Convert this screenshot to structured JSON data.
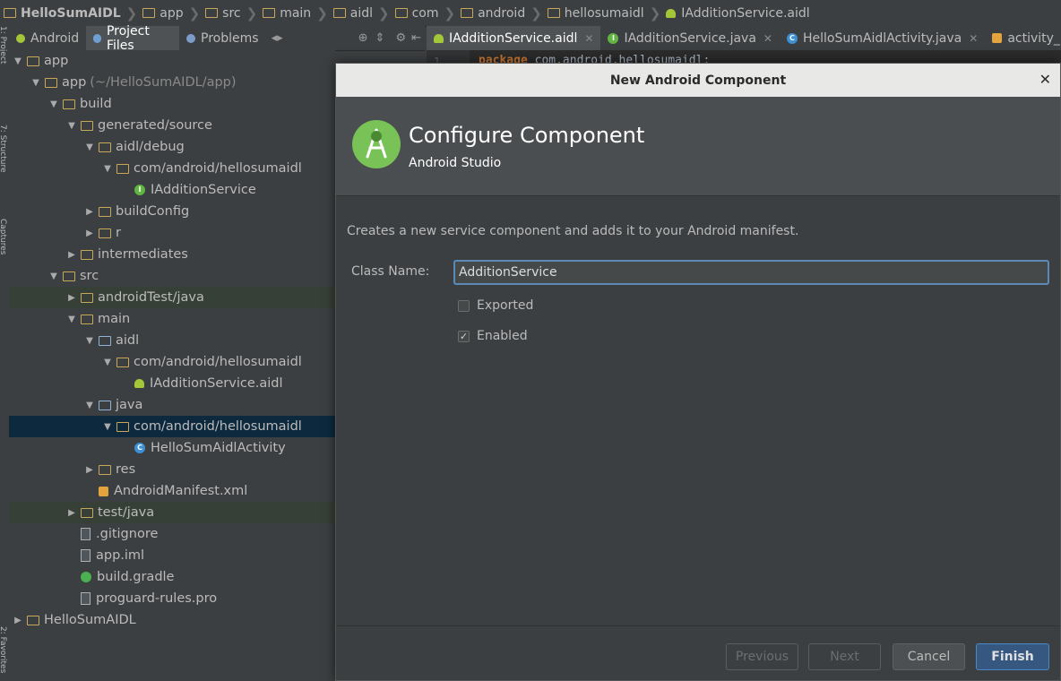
{
  "breadcrumb": [
    {
      "label": "HelloSumAIDL",
      "icon": "project-icon"
    },
    {
      "label": "app",
      "icon": "folder-icon"
    },
    {
      "label": "src",
      "icon": "folder-icon"
    },
    {
      "label": "main",
      "icon": "folder-icon"
    },
    {
      "label": "aidl",
      "icon": "folder-icon"
    },
    {
      "label": "com",
      "icon": "folder-icon"
    },
    {
      "label": "android",
      "icon": "folder-icon"
    },
    {
      "label": "hellosumaidl",
      "icon": "folder-icon"
    },
    {
      "label": "IAdditionService.aidl",
      "icon": "android-icon"
    }
  ],
  "left_strip": {
    "project": "1: Project",
    "structure": "7: Structure",
    "captures": "Captures",
    "favorites": "2: Favorites"
  },
  "project_tabs": [
    {
      "label": "Android",
      "icon": "android-icon"
    },
    {
      "label": "Project Files",
      "icon": "project-files-icon",
      "active": true
    },
    {
      "label": "Problems",
      "icon": "problems-icon"
    }
  ],
  "tree": [
    {
      "label": "app",
      "depth": 0,
      "arrow": "▼",
      "icon": "folder"
    },
    {
      "label": "app",
      "muted": "(~/HelloSumAIDL/app)",
      "depth": 1,
      "arrow": "▼",
      "icon": "folder"
    },
    {
      "label": "build",
      "depth": 2,
      "arrow": "▼",
      "icon": "folder"
    },
    {
      "label": "generated/source",
      "depth": 3,
      "arrow": "▼",
      "icon": "folder"
    },
    {
      "label": "aidl/debug",
      "depth": 4,
      "arrow": "▼",
      "icon": "folder"
    },
    {
      "label": "com/android/hellosumaidl",
      "depth": 5,
      "arrow": "▼",
      "icon": "folder"
    },
    {
      "label": "IAdditionService",
      "depth": 6,
      "arrow": "",
      "icon": "interface"
    },
    {
      "label": "buildConfig",
      "depth": 4,
      "arrow": "▶",
      "icon": "folder"
    },
    {
      "label": "r",
      "depth": 4,
      "arrow": "▶",
      "icon": "folder"
    },
    {
      "label": "intermediates",
      "depth": 3,
      "arrow": "▶",
      "icon": "folder"
    },
    {
      "label": "src",
      "depth": 2,
      "arrow": "▼",
      "icon": "folder"
    },
    {
      "label": "androidTest/java",
      "depth": 3,
      "arrow": "▶",
      "icon": "folder",
      "highlight": "green"
    },
    {
      "label": "main",
      "depth": 3,
      "arrow": "▼",
      "icon": "folder"
    },
    {
      "label": "aidl",
      "depth": 4,
      "arrow": "▼",
      "icon": "folder-blue"
    },
    {
      "label": "com/android/hellosumaidl",
      "depth": 5,
      "arrow": "▼",
      "icon": "folder"
    },
    {
      "label": "IAdditionService.aidl",
      "depth": 6,
      "arrow": "",
      "icon": "android"
    },
    {
      "label": "java",
      "depth": 4,
      "arrow": "▼",
      "icon": "folder-blue"
    },
    {
      "label": "com/android/hellosumaidl",
      "depth": 5,
      "arrow": "▼",
      "icon": "folder",
      "highlight": "selected"
    },
    {
      "label": "HelloSumAidlActivity",
      "depth": 6,
      "arrow": "",
      "icon": "class"
    },
    {
      "label": "res",
      "depth": 4,
      "arrow": "▶",
      "icon": "folder"
    },
    {
      "label": "AndroidManifest.xml",
      "depth": 4,
      "arrow": "",
      "icon": "xml"
    },
    {
      "label": "test/java",
      "depth": 3,
      "arrow": "▶",
      "icon": "folder",
      "highlight": "green"
    },
    {
      "label": ".gitignore",
      "depth": 3,
      "arrow": "",
      "icon": "file"
    },
    {
      "label": "app.iml",
      "depth": 3,
      "arrow": "",
      "icon": "file"
    },
    {
      "label": "build.gradle",
      "depth": 3,
      "arrow": "",
      "icon": "gradle"
    },
    {
      "label": "proguard-rules.pro",
      "depth": 3,
      "arrow": "",
      "icon": "file"
    },
    {
      "label": "HelloSumAIDL",
      "depth": 0,
      "arrow": "▶",
      "icon": "folder"
    }
  ],
  "editor_tabs": [
    {
      "label": "IAdditionService.aidl",
      "icon": "android-icon",
      "active": true
    },
    {
      "label": "IAdditionService.java",
      "icon": "interface-icon"
    },
    {
      "label": "HelloSumAidlActivity.java",
      "icon": "class-icon"
    },
    {
      "label": "activity_hello...",
      "icon": "xml-icon"
    }
  ],
  "editor": {
    "line_number": "1",
    "keyword": "package",
    "code": " com.android.hellosumaidl;"
  },
  "dialog": {
    "title": "New Android Component",
    "heading": "Configure Component",
    "subheading": "Android Studio",
    "description": "Creates a new service component and adds it to your Android manifest.",
    "class_name_label": "Class Name:",
    "class_name_value": "AdditionService",
    "exported_label": "Exported",
    "exported_checked": false,
    "enabled_label": "Enabled",
    "enabled_checked": true,
    "buttons": {
      "previous": "Previous",
      "next": "Next",
      "cancel": "Cancel",
      "finish": "Finish"
    }
  },
  "colors": {
    "accent": "#365880",
    "android_green": "#a4c639",
    "selection": "#0d293e"
  }
}
